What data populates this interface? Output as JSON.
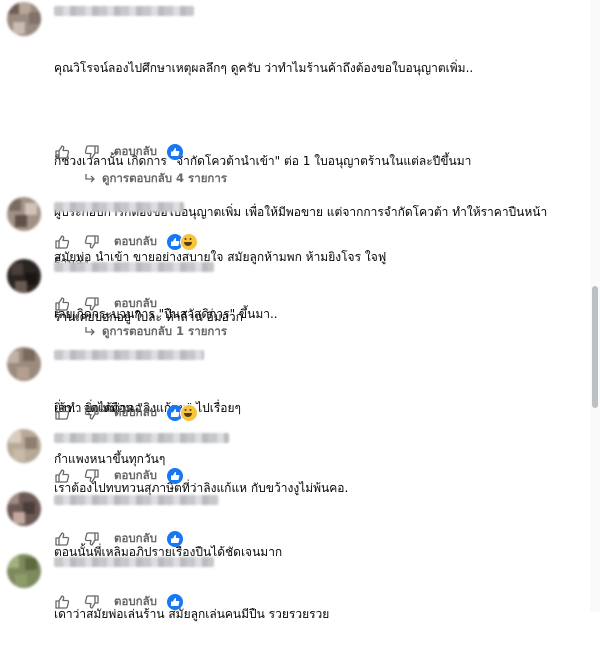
{
  "reply_label": "ตอบกลับ",
  "comments": [
    {
      "lines": [
        "คุณวิโรจน์ลองไปศึกษาเหตุผลลึกๆ ดูครับ ว่าทำไมร้านค้าถึงต้องขอใบอนุญาตเพิ่ม..",
        "",
        "ก็ช่วงเวลานั้น เกิดการ \"จำกัดโควต้านำเข้า\" ต่อ 1 ใบอนุญาตร้านในแต่ละปีขึ้นมา",
        "ผู้ประกอบการก็ต้องขอใบอนุญาตเพิ่ม เพื่อให้มีพอขาย แต่จากการจำกัดโควต้า ทำให้ราคาปืนหน้า",
        "ร้านสูง",
        "เลยเกิดกระบวนการ \"ปืนสวัสดิการ\" ขึ้นมา..",
        "",
        "ยิ่งทำ ยิ่งเหมือน \"ลิงแก้แห\" ไปเรื่อยๆ"
      ],
      "reactions": [
        "like"
      ],
      "view_replies": "ดูการตอบกลับ 4 รายการ"
    },
    {
      "lines": [
        "สมัยพ่อ นำเข้า ขายอย่างสบายใจ สมัยลูกห้ามพก ห้ามยิงโจร ใจฟู"
      ],
      "reactions": [
        "like",
        "haha"
      ],
      "view_replies": ""
    },
    {
      "lines": [
        "ร้านเคยบอกอยู่ ใบละ ห้าล้าน อิ่มอวก"
      ],
      "reactions": [],
      "view_replies": "ดูการตอบกลับ 1 รายการ"
    },
    {
      "lines": [
        "เอ้า.. จุดได้ต่าดอ",
        "กำแพงหนาขึ้นทุกวันๆ"
      ],
      "reactions": [
        "like",
        "haha"
      ],
      "view_replies": ""
    },
    {
      "lines": [
        "เราต้องไปทบทวนสุภาษิตที่ว่าลิงแก้แห กับขว้างงูไม่พ้นคอ."
      ],
      "reactions": [
        "like"
      ],
      "view_replies": ""
    },
    {
      "lines": [
        "ตอนนั้นพี่เหลิมอภิปรายเรื่องปืนได้ชัดเจนมาก"
      ],
      "reactions": [
        "like"
      ],
      "view_replies": ""
    },
    {
      "lines": [
        "เดาว่าสมัยพ่อเล่นร้าน สมัยลูกเล่นคนมีปืน รวยรวยรวย"
      ],
      "reactions": [
        "like"
      ],
      "view_replies": ""
    }
  ],
  "icons": {
    "like": "thumbs-up-icon",
    "dislike": "thumbs-down-icon",
    "reply_arrow": "reply-arrow-icon",
    "reaction_like": "like-reaction-icon",
    "reaction_haha": "haha-reaction-icon"
  },
  "colors": {
    "text": "#050505",
    "muted": "#65676b",
    "like_blue": "#1877f2",
    "haha_yellow": "#f7c340"
  }
}
